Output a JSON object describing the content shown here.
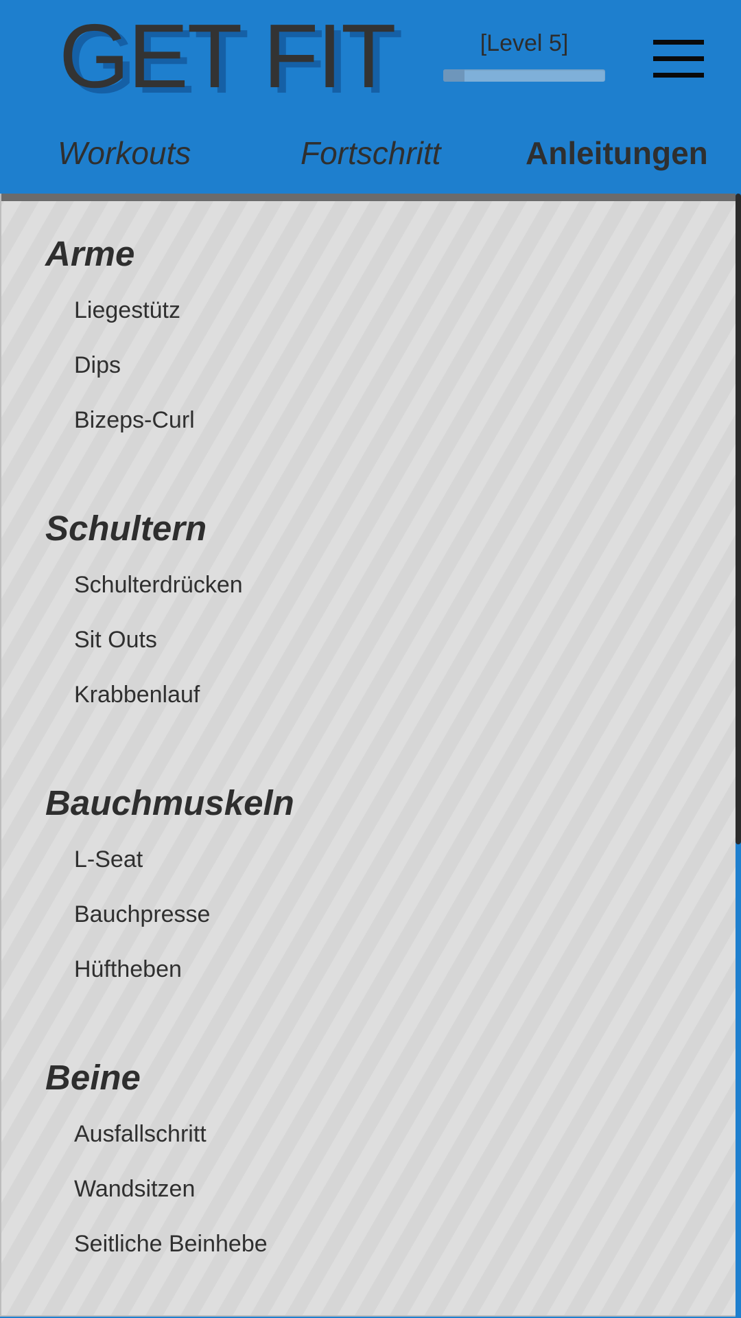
{
  "app": {
    "logo": "GET FIT",
    "level_label": "[Level 5]",
    "level_progress_fraction": 0.13,
    "menu_icon": "hamburger-menu-icon"
  },
  "tabs": [
    {
      "label": "Workouts",
      "active": false
    },
    {
      "label": "Fortschritt",
      "active": false
    },
    {
      "label": "Anleitungen",
      "active": true
    }
  ],
  "sections": [
    {
      "title": "Arme",
      "items": [
        "Liegestütz",
        "Dips",
        "Bizeps-Curl"
      ]
    },
    {
      "title": "Schultern",
      "items": [
        "Schulterdrücken",
        "Sit Outs",
        "Krabbenlauf"
      ]
    },
    {
      "title": "Bauchmuskeln",
      "items": [
        "L-Seat",
        "Bauchpresse",
        "Hüftheben"
      ]
    },
    {
      "title": "Beine",
      "items": [
        "Ausfallschritt",
        "Wandsitzen",
        "Seitliche Beinhebe"
      ]
    }
  ],
  "colors": {
    "header_bg": "#1e7fce",
    "content_bg": "#dcdcdc",
    "text": "#2f2f2f"
  }
}
